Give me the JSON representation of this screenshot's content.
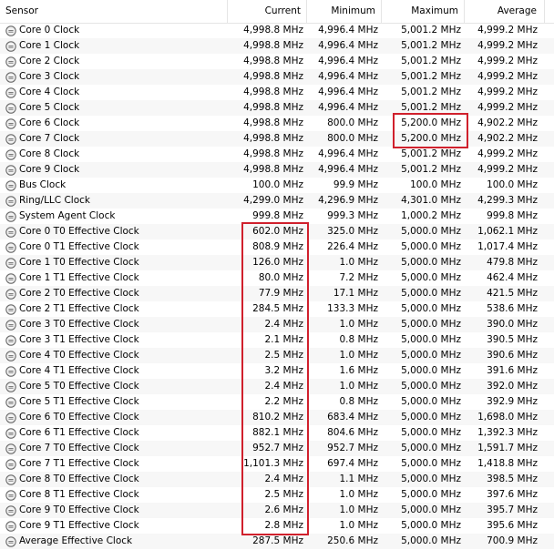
{
  "headers": [
    "Sensor",
    "Current",
    "Minimum",
    "Maximum",
    "Average"
  ],
  "icon": "clock-sensor-icon",
  "highlight_color": "#d0202c",
  "rows": [
    [
      "Core 0 Clock",
      "4,998.8 MHz",
      "4,996.4 MHz",
      "5,001.2 MHz",
      "4,999.2 MHz"
    ],
    [
      "Core 1 Clock",
      "4,998.8 MHz",
      "4,996.4 MHz",
      "5,001.2 MHz",
      "4,999.2 MHz"
    ],
    [
      "Core 2 Clock",
      "4,998.8 MHz",
      "4,996.4 MHz",
      "5,001.2 MHz",
      "4,999.2 MHz"
    ],
    [
      "Core 3 Clock",
      "4,998.8 MHz",
      "4,996.4 MHz",
      "5,001.2 MHz",
      "4,999.2 MHz"
    ],
    [
      "Core 4 Clock",
      "4,998.8 MHz",
      "4,996.4 MHz",
      "5,001.2 MHz",
      "4,999.2 MHz"
    ],
    [
      "Core 5 Clock",
      "4,998.8 MHz",
      "4,996.4 MHz",
      "5,001.2 MHz",
      "4,999.2 MHz"
    ],
    [
      "Core 6 Clock",
      "4,998.8 MHz",
      "800.0 MHz",
      "5,200.0 MHz",
      "4,902.2 MHz"
    ],
    [
      "Core 7 Clock",
      "4,998.8 MHz",
      "800.0 MHz",
      "5,200.0 MHz",
      "4,902.2 MHz"
    ],
    [
      "Core 8 Clock",
      "4,998.8 MHz",
      "4,996.4 MHz",
      "5,001.2 MHz",
      "4,999.2 MHz"
    ],
    [
      "Core 9 Clock",
      "4,998.8 MHz",
      "4,996.4 MHz",
      "5,001.2 MHz",
      "4,999.2 MHz"
    ],
    [
      "Bus Clock",
      "100.0 MHz",
      "99.9 MHz",
      "100.0 MHz",
      "100.0 MHz"
    ],
    [
      "Ring/LLC Clock",
      "4,299.0 MHz",
      "4,296.9 MHz",
      "4,301.0 MHz",
      "4,299.3 MHz"
    ],
    [
      "System Agent Clock",
      "999.8 MHz",
      "999.3 MHz",
      "1,000.2 MHz",
      "999.8 MHz"
    ],
    [
      "Core 0 T0 Effective Clock",
      "602.0 MHz",
      "325.0 MHz",
      "5,000.0 MHz",
      "1,062.1 MHz"
    ],
    [
      "Core 0 T1 Effective Clock",
      "808.9 MHz",
      "226.4 MHz",
      "5,000.0 MHz",
      "1,017.4 MHz"
    ],
    [
      "Core 1 T0 Effective Clock",
      "126.0 MHz",
      "1.0 MHz",
      "5,000.0 MHz",
      "479.8 MHz"
    ],
    [
      "Core 1 T1 Effective Clock",
      "80.0 MHz",
      "7.2 MHz",
      "5,000.0 MHz",
      "462.4 MHz"
    ],
    [
      "Core 2 T0 Effective Clock",
      "77.9 MHz",
      "17.1 MHz",
      "5,000.0 MHz",
      "421.5 MHz"
    ],
    [
      "Core 2 T1 Effective Clock",
      "284.5 MHz",
      "133.3 MHz",
      "5,000.0 MHz",
      "538.6 MHz"
    ],
    [
      "Core 3 T0 Effective Clock",
      "2.4 MHz",
      "1.0 MHz",
      "5,000.0 MHz",
      "390.0 MHz"
    ],
    [
      "Core 3 T1 Effective Clock",
      "2.1 MHz",
      "0.8 MHz",
      "5,000.0 MHz",
      "390.5 MHz"
    ],
    [
      "Core 4 T0 Effective Clock",
      "2.5 MHz",
      "1.0 MHz",
      "5,000.0 MHz",
      "390.6 MHz"
    ],
    [
      "Core 4 T1 Effective Clock",
      "3.2 MHz",
      "1.6 MHz",
      "5,000.0 MHz",
      "391.6 MHz"
    ],
    [
      "Core 5 T0 Effective Clock",
      "2.4 MHz",
      "1.0 MHz",
      "5,000.0 MHz",
      "392.0 MHz"
    ],
    [
      "Core 5 T1 Effective Clock",
      "2.2 MHz",
      "0.8 MHz",
      "5,000.0 MHz",
      "392.9 MHz"
    ],
    [
      "Core 6 T0 Effective Clock",
      "810.2 MHz",
      "683.4 MHz",
      "5,000.0 MHz",
      "1,698.0 MHz"
    ],
    [
      "Core 6 T1 Effective Clock",
      "882.1 MHz",
      "804.6 MHz",
      "5,000.0 MHz",
      "1,392.3 MHz"
    ],
    [
      "Core 7 T0 Effective Clock",
      "952.7 MHz",
      "952.7 MHz",
      "5,000.0 MHz",
      "1,591.7 MHz"
    ],
    [
      "Core 7 T1 Effective Clock",
      "1,101.3 MHz",
      "697.4 MHz",
      "5,000.0 MHz",
      "1,418.8 MHz"
    ],
    [
      "Core 8 T0 Effective Clock",
      "2.4 MHz",
      "1.1 MHz",
      "5,000.0 MHz",
      "398.5 MHz"
    ],
    [
      "Core 8 T1 Effective Clock",
      "2.5 MHz",
      "1.0 MHz",
      "5,000.0 MHz",
      "397.6 MHz"
    ],
    [
      "Core 9 T0 Effective Clock",
      "2.6 MHz",
      "1.0 MHz",
      "5,000.0 MHz",
      "395.7 MHz"
    ],
    [
      "Core 9 T1 Effective Clock",
      "2.8 MHz",
      "1.0 MHz",
      "5,000.0 MHz",
      "395.6 MHz"
    ],
    [
      "Average Effective Clock",
      "287.5 MHz",
      "250.6 MHz",
      "5,000.0 MHz",
      "700.9 MHz"
    ]
  ]
}
